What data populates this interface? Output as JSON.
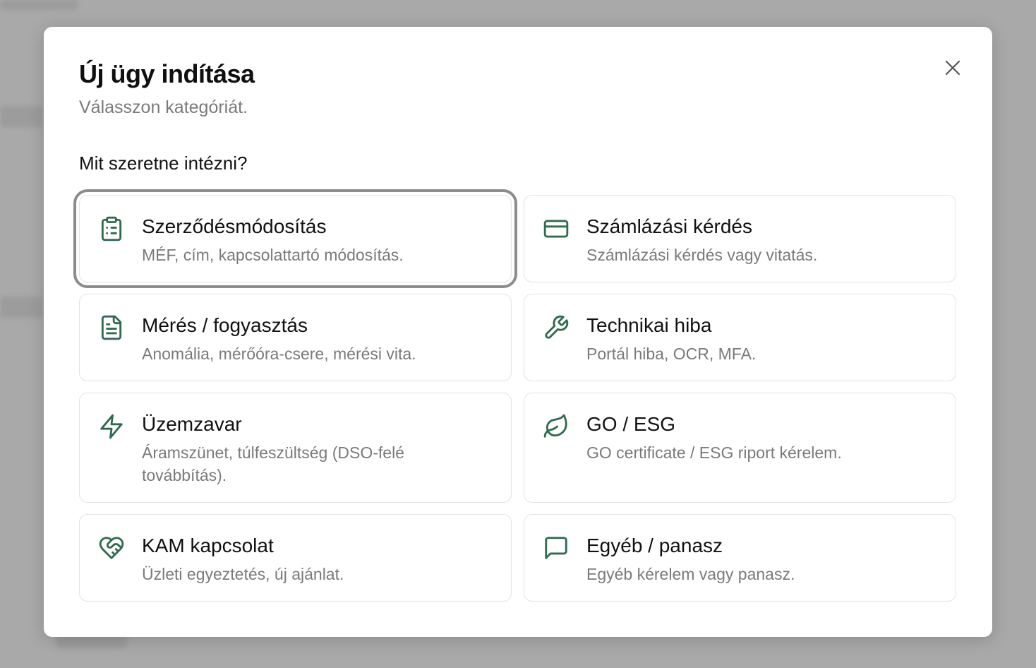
{
  "modal": {
    "title": "Új ügy indítása",
    "subtitle": "Válasszon kategóriát.",
    "question": "Mit szeretne intézni?"
  },
  "colors": {
    "accent": "#2e6b4f",
    "selected_outline": "#8c8c8c",
    "card_border": "#e3e3e3"
  },
  "categories": [
    {
      "title": "Szerződésmódosítás",
      "description": "MÉF, cím, kapcsolattartó módosítás.",
      "icon": "clipboard-list-icon",
      "selected": true
    },
    {
      "title": "Számlázási kérdés",
      "description": "Számlázási kérdés vagy vitatás.",
      "icon": "credit-card-icon",
      "selected": false
    },
    {
      "title": "Mérés / fogyasztás",
      "description": "Anomália, mérőóra-csere, mérési vita.",
      "icon": "file-text-icon",
      "selected": false
    },
    {
      "title": "Technikai hiba",
      "description": "Portál hiba, OCR, MFA.",
      "icon": "wrench-icon",
      "selected": false
    },
    {
      "title": "Üzemzavar",
      "description": "Áramszünet, túlfeszültség (DSO-felé továbbítás).",
      "icon": "zap-icon",
      "selected": false
    },
    {
      "title": "GO / ESG",
      "description": "GO certificate / ESG riport kérelem.",
      "icon": "leaf-icon",
      "selected": false
    },
    {
      "title": "KAM kapcsolat",
      "description": "Üzleti egyeztetés, új ajánlat.",
      "icon": "handshake-heart-icon",
      "selected": false
    },
    {
      "title": "Egyéb / panasz",
      "description": "Egyéb kérelem vagy panasz.",
      "icon": "message-square-icon",
      "selected": false
    }
  ]
}
